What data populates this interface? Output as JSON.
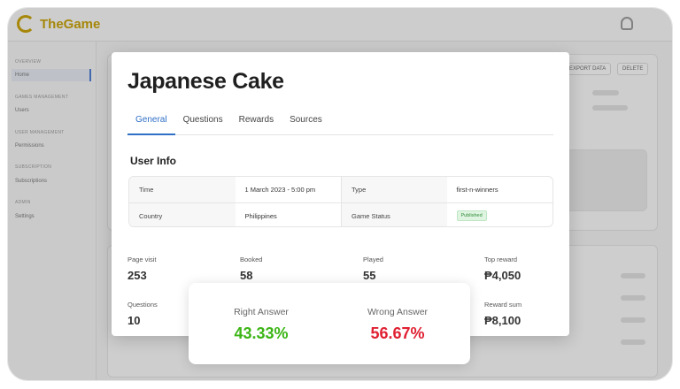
{
  "background": {
    "app_name": "TheGame",
    "sidebar": {
      "groups": [
        "OVERVIEW",
        "GAMES MANAGEMENT",
        "USER MANAGEMENT",
        "SUBSCRIPTION",
        "ADMIN"
      ],
      "items": [
        "Home",
        "Users",
        "Permissions",
        "Subscriptions",
        "Settings"
      ]
    },
    "buttons": [
      "EXPORT DATA",
      "DELETE"
    ]
  },
  "modal": {
    "title": "Japanese Cake",
    "tabs": [
      {
        "label": "General",
        "active": true
      },
      {
        "label": "Questions",
        "active": false
      },
      {
        "label": "Rewards",
        "active": false
      },
      {
        "label": "Sources",
        "active": false
      }
    ],
    "section_title": "User Info",
    "info": {
      "time_label": "Time",
      "time_value": "1 March 2023 - 5:00  pm",
      "type_label": "Type",
      "type_value": "first-n-winners",
      "country_label": "Country",
      "country_value": "Philippines",
      "status_label": "Game Status",
      "status_value": "Published"
    },
    "stats": {
      "page_visit_label": "Page visit",
      "page_visit_value": "253",
      "booked_label": "Booked",
      "booked_value": "58",
      "played_label": "Played",
      "played_value": "55",
      "top_reward_label": "Top reward",
      "top_reward_value": "₱4,050",
      "questions_label": "Questions",
      "questions_value": "10",
      "reward_sum_label": "Reward sum",
      "reward_sum_value": "₱8,100"
    }
  },
  "answers": {
    "right_label": "Right Answer",
    "right_value": "43.33%",
    "right_color": "#3bb515",
    "wrong_label": "Wrong Answer",
    "wrong_value": "56.67%",
    "wrong_color": "#e02032"
  },
  "colors": {
    "accent": "#2f6fc6",
    "brand": "#c9a200",
    "badge_bg": "#dff5e1"
  }
}
